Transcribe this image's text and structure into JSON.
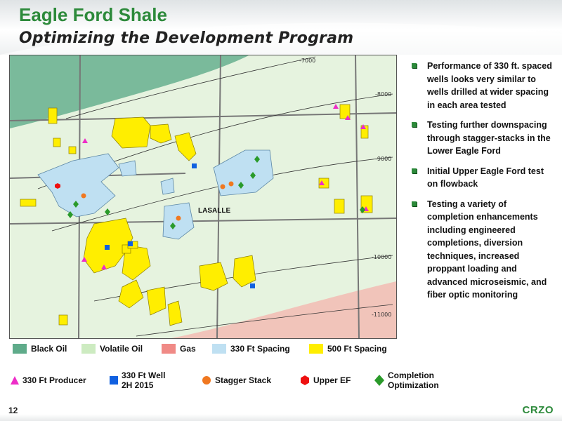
{
  "header": {
    "title": "Eagle Ford Shale",
    "subtitle": "Optimizing the Development Program"
  },
  "map": {
    "town_label": "LASALLE",
    "contours": [
      "-7000",
      "-8000",
      "-9000",
      "-10000",
      "-11000"
    ]
  },
  "bullets": [
    "Performance of 330 ft. spaced wells looks very similar to wells drilled at wider spacing in each area tested",
    "Testing further downspacing through stagger-stacks in the Lower Eagle Ford",
    "Initial Upper Eagle Ford test on flowback",
    "Testing a variety of completion enhancements including engineered completions, diversion techniques, increased proppant loading and advanced microseismic, and fiber optic monitoring"
  ],
  "legend": [
    {
      "label": "Black Oil",
      "color": "#5fab8a"
    },
    {
      "label": "Volatile Oil",
      "color": "#cdebc1"
    },
    {
      "label": "Gas",
      "color": "#f08a86"
    },
    {
      "label": "330 Ft Spacing",
      "color": "#bfe0f2"
    },
    {
      "label": "500 Ft Spacing",
      "color": "#ffee00"
    }
  ],
  "symbols": [
    {
      "label": "330 Ft Producer",
      "icon": "triangle-icon",
      "color": "#ee2cc8"
    },
    {
      "label_line1": "330 Ft Well",
      "label_line2": "2H 2015",
      "icon": "square-icon",
      "color": "#1060e0"
    },
    {
      "label": "Stagger Stack",
      "icon": "circle-icon",
      "color": "#f07820"
    },
    {
      "label": "Upper EF",
      "icon": "hexagon-icon",
      "color": "#ee1010"
    },
    {
      "label_line1": "Completion",
      "label_line2": "Optimization",
      "icon": "diamond-icon",
      "color": "#2a9a2a"
    }
  ],
  "footer": {
    "page_number": "12",
    "logo": "CRZO"
  },
  "colors": {
    "brand_green": "#2d8a3b",
    "map_outline": "#7a6e00"
  }
}
